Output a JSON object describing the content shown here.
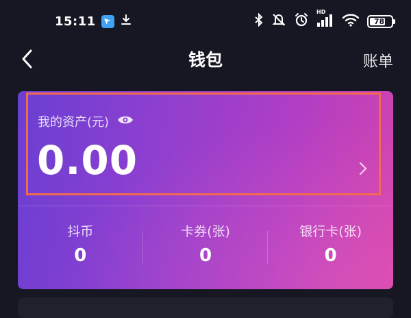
{
  "status_bar": {
    "time": "15:11",
    "battery": "78",
    "network": "HD"
  },
  "nav": {
    "title": "钱包",
    "right_link": "账单"
  },
  "wallet": {
    "asset_label": "我的资产(元)",
    "asset_amount": "0.00",
    "stats": [
      {
        "label": "抖币",
        "value": "0"
      },
      {
        "label": "卡券(张)",
        "value": "0"
      },
      {
        "label": "银行卡(张)",
        "value": "0"
      }
    ]
  },
  "colors": {
    "background": "#161722",
    "card_gradient_start": "#6a3fd2",
    "card_gradient_end": "#d444ae",
    "highlight_border": "#f36b4f"
  }
}
